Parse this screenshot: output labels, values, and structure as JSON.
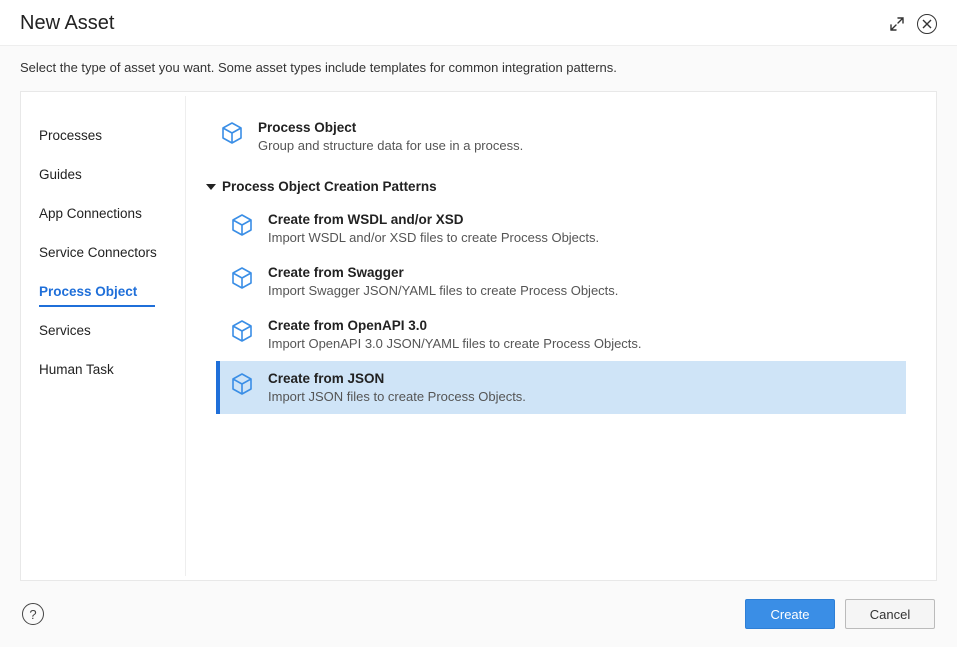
{
  "header": {
    "title": "New Asset"
  },
  "subheader": "Select the type of asset you want. Some asset types include templates for common integration patterns.",
  "sidebar": {
    "items": [
      {
        "label": "Processes"
      },
      {
        "label": "Guides"
      },
      {
        "label": "App Connections"
      },
      {
        "label": "Service Connectors"
      },
      {
        "label": "Process Object",
        "active": true
      },
      {
        "label": "Services"
      },
      {
        "label": "Human Task"
      }
    ]
  },
  "content": {
    "primary": {
      "title": "Process Object",
      "desc": "Group and structure data for use in a process."
    },
    "section_title": "Process Object Creation Patterns",
    "patterns": [
      {
        "title": "Create from WSDL and/or XSD",
        "desc": "Import WSDL and/or XSD files to create Process Objects."
      },
      {
        "title": "Create from Swagger",
        "desc": "Import Swagger JSON/YAML files to create Process Objects."
      },
      {
        "title": "Create from OpenAPI 3.0",
        "desc": "Import OpenAPI 3.0 JSON/YAML files to create Process Objects."
      },
      {
        "title": "Create from JSON",
        "desc": "Import JSON files to create Process Objects.",
        "selected": true
      }
    ]
  },
  "footer": {
    "create_label": "Create",
    "cancel_label": "Cancel"
  }
}
